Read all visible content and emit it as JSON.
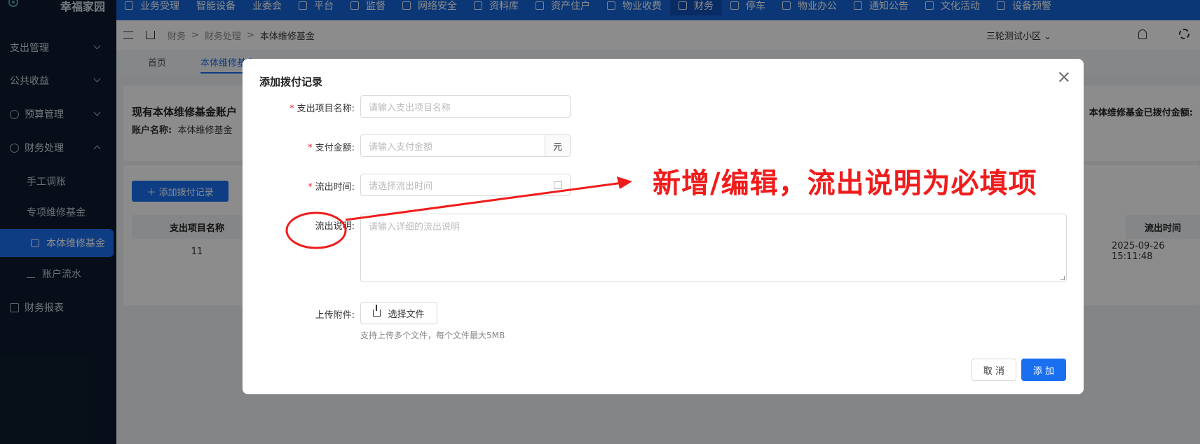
{
  "app": {
    "name": "幸福家园"
  },
  "topnav": {
    "items": [
      {
        "label": "业务受理",
        "icon": "form-icon"
      },
      {
        "label": "智能设备",
        "icon": ""
      },
      {
        "label": "业委会",
        "icon": ""
      },
      {
        "label": "平台",
        "icon": "home-icon"
      },
      {
        "label": "监督",
        "icon": "share-icon"
      },
      {
        "label": "网络安全",
        "icon": "shield-icon"
      },
      {
        "label": "资料库",
        "icon": "doc-icon"
      },
      {
        "label": "资产住户",
        "icon": "home-icon"
      },
      {
        "label": "物业收费",
        "icon": "bill-icon"
      },
      {
        "label": "财务",
        "icon": "finance-icon"
      },
      {
        "label": "停车",
        "icon": "car-icon"
      },
      {
        "label": "物业办公",
        "icon": "monitor-icon"
      },
      {
        "label": "通知公告",
        "icon": "megaphone-icon"
      },
      {
        "label": "文化活动",
        "icon": "culture-icon"
      },
      {
        "label": "设备预警",
        "icon": "alarm-icon"
      }
    ],
    "active_index": 9
  },
  "sidebar": {
    "groups": [
      {
        "label": "支出管理"
      },
      {
        "label": "公共收益"
      },
      {
        "label": "预算管理"
      },
      {
        "label": "财务处理"
      }
    ],
    "sub_items": [
      {
        "label": "手工调账"
      },
      {
        "label": "专项维修基金"
      },
      {
        "label": "本体维修基金"
      },
      {
        "label": "账户流水"
      }
    ],
    "bottom": {
      "label": "财务报表"
    }
  },
  "breadcrumb": {
    "a": "财务",
    "sep": ">",
    "b": "财务处理",
    "c": "本体维修基金"
  },
  "header": {
    "community": "三轮测试小区"
  },
  "tabs": {
    "home": "首页",
    "current": "本体维修基金"
  },
  "background": {
    "account_title": "现有本体维修基金账户",
    "account_label": "账户名称:",
    "account_value": "本体维修基金",
    "paid_title": "本体维修基金已拨付金额:",
    "add_button": "添加拨付记录",
    "col_name": "支出项目名称",
    "col_time": "流出时间",
    "row_name": "11",
    "row_time": "2025-09-26 15:11:48"
  },
  "modal": {
    "title": "添加拨付记录",
    "fields": {
      "project_label": "支出项目名称:",
      "project_placeholder": "请输入支出项目名称",
      "amount_label": "支付金额:",
      "amount_placeholder": "请输入支付金额",
      "amount_suffix": "元",
      "time_label": "流出时间:",
      "time_placeholder": "请选择流出时间",
      "desc_label": "流出说明:",
      "desc_placeholder": "请输入详细的流出说明",
      "upload_label": "上传附件:",
      "upload_button": "选择文件",
      "upload_hint": "支持上传多个文件，每个文件最大5MB"
    },
    "cancel": "取 消",
    "submit": "添 加"
  },
  "annotation": {
    "text": "新增/编辑，流出说明为必填项",
    "color": "#f01c1c"
  },
  "colors": {
    "primary": "#1a6ff0",
    "nav": "#1565d8",
    "sidebar": "#0d1b2e",
    "required": "#f5222d"
  }
}
